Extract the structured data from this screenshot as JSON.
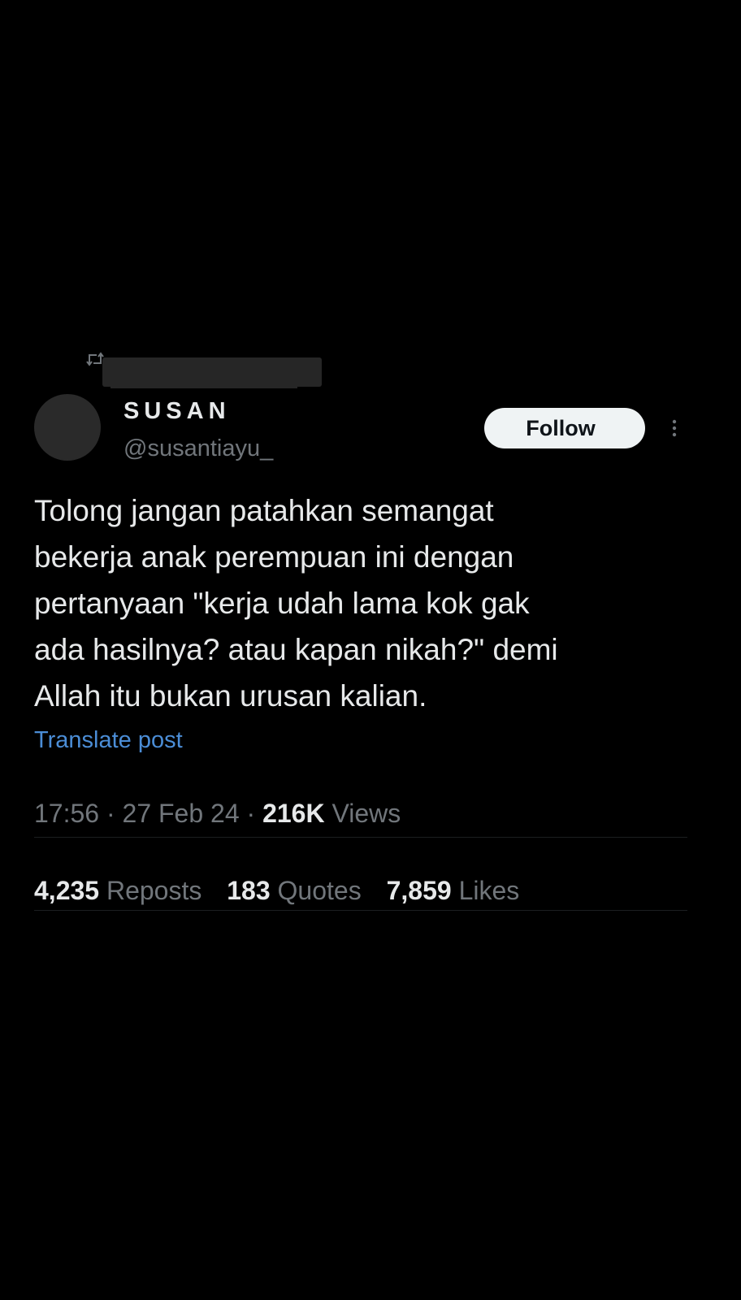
{
  "repost_context": {
    "icon": "repost-icon",
    "redacted": true
  },
  "author": {
    "display_name": "SUSAN",
    "handle": "@susantiayu_"
  },
  "follow_label": "Follow",
  "more_icon": "more-vertical-icon",
  "tweet": {
    "text": "Tolong jangan patahkan semangat\nbekerja anak perempuan ini dengan\npertanyaan \"kerja udah lama kok gak\nada hasilnya? atau kapan nikah?\" demi\nAllah itu bukan urusan kalian.",
    "translate_label": "Translate post"
  },
  "meta": {
    "time": "17:56",
    "separator": "·",
    "date": "27 Feb 24",
    "views_count": "216K",
    "views_label": "Views"
  },
  "stats": [
    {
      "count": "4,235",
      "label": "Reposts"
    },
    {
      "count": "183",
      "label": "Quotes"
    },
    {
      "count": "7,859",
      "label": "Likes"
    }
  ],
  "colors": {
    "background": "#000000",
    "text_primary": "#e7e9ea",
    "text_secondary": "#71767b",
    "link": "#4b8dd6",
    "follow_bg": "#eff3f4"
  }
}
